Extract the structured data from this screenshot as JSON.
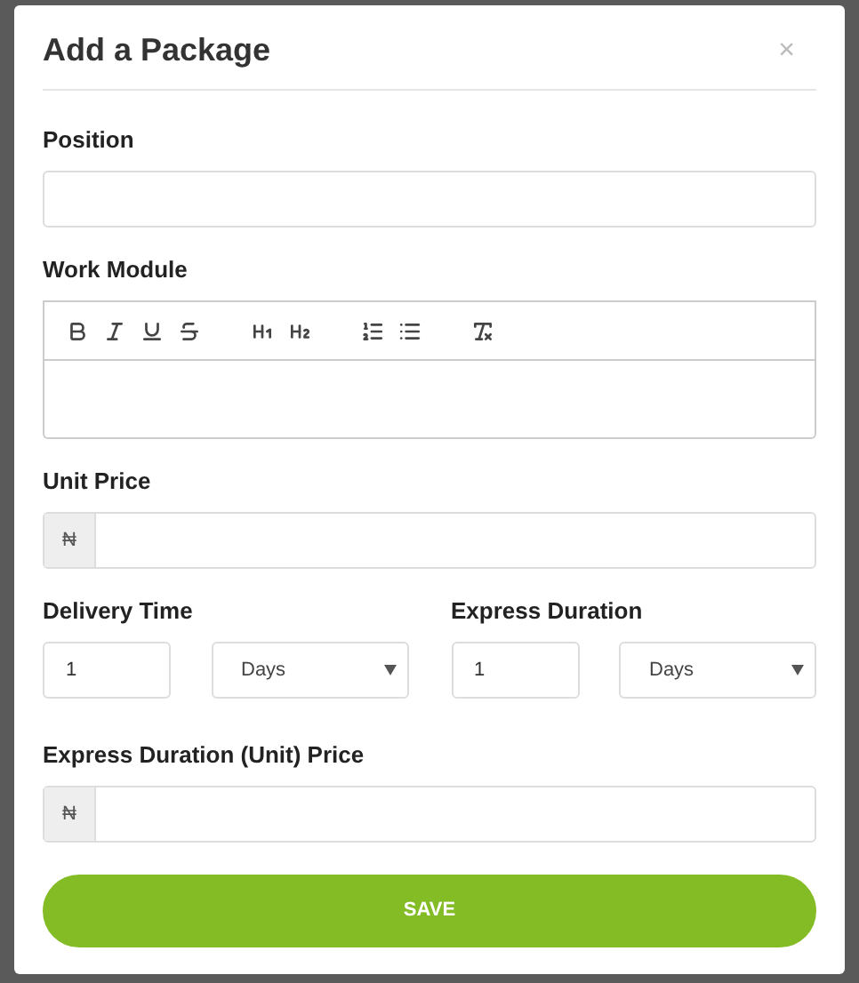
{
  "dialog": {
    "title": "Add a Package",
    "close": "×"
  },
  "position": {
    "label": "Position"
  },
  "work_module": {
    "label": "Work Module",
    "toolbar": [
      {
        "kind": "bold"
      },
      {
        "kind": "italic"
      },
      {
        "kind": "underline"
      },
      {
        "kind": "strike"
      },
      {
        "kind": "gap"
      },
      {
        "kind": "h1"
      },
      {
        "kind": "h2"
      },
      {
        "kind": "gap"
      },
      {
        "kind": "ordered"
      },
      {
        "kind": "bullet"
      },
      {
        "kind": "gap"
      },
      {
        "kind": "clear"
      }
    ]
  },
  "unit_price": {
    "label": "Unit Price",
    "prefix": "₦"
  },
  "delivery_time": {
    "label": "Delivery Time",
    "value": "1",
    "unit": "Days"
  },
  "express_duration": {
    "label": "Express Duration",
    "value": "1",
    "unit": "Days"
  },
  "express_price": {
    "label": "Express Duration (Unit) Price",
    "prefix": "₦"
  },
  "save": "SAVE"
}
